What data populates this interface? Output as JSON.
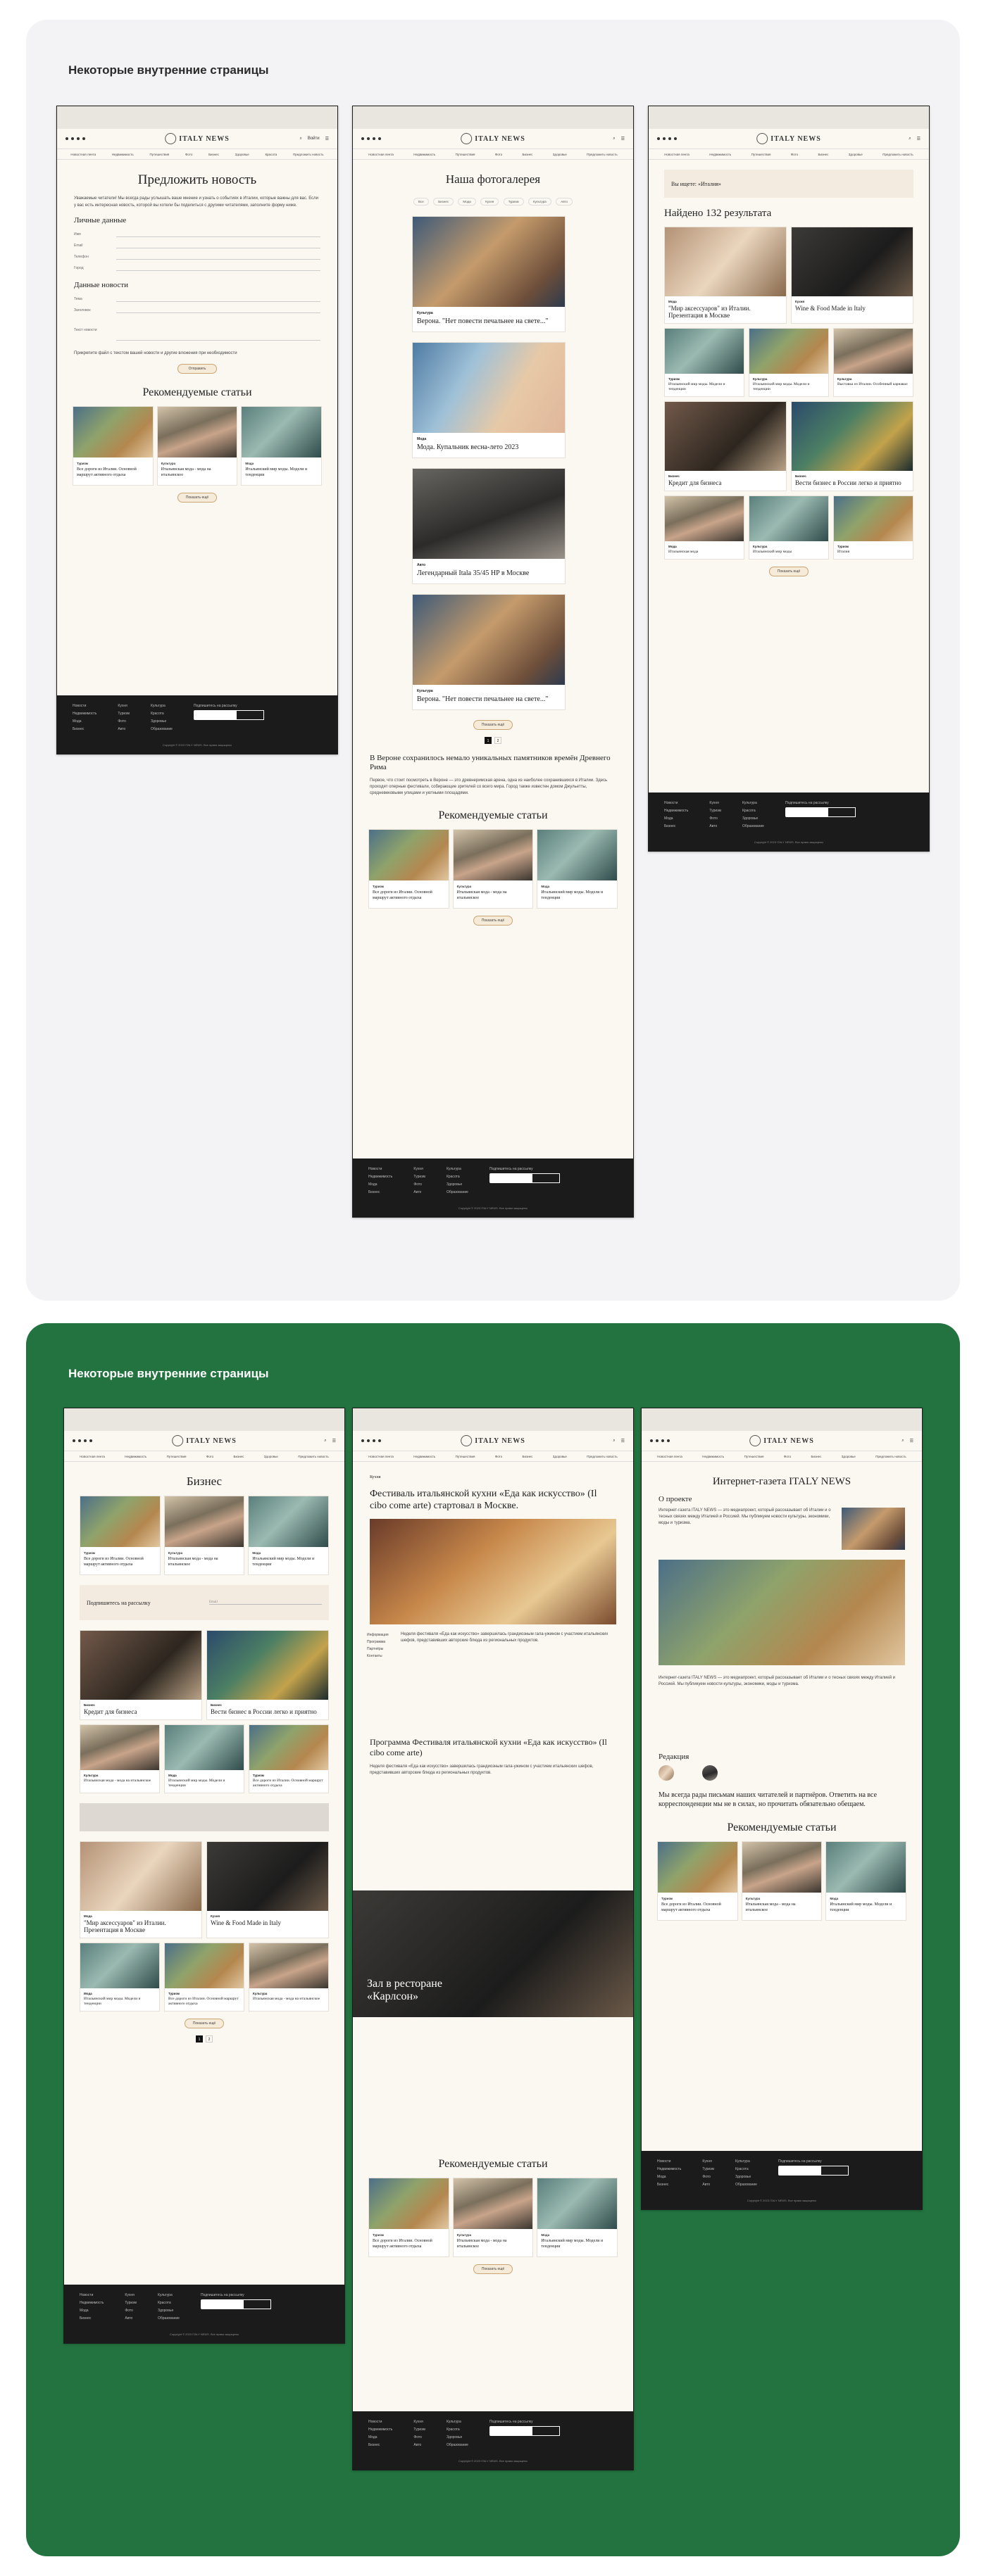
{
  "board1": {
    "title": "Некоторые внутренние страницы"
  },
  "board2": {
    "title": "Некоторые внутренние страницы"
  },
  "logo_text": "ITALY NEWS",
  "nav_items": [
    "Новостная лента",
    "Недвижимость",
    "Путешествия",
    "Фото",
    "Бизнес",
    "Здоровье",
    "Красота",
    "Мода",
    "Туризм",
    "Образование",
    "Культура",
    "Кухня",
    "Предложить новость"
  ],
  "pages": {
    "suggest": {
      "title": "Предложить новость",
      "intro": "Уважаемые читатели! Мы всегда рады услышать ваше мнение и узнать о событиях в Италии, которые важны для вас. Если у вас есть интересная новость, которой вы хотели бы поделиться с другими читателями, заполните форму ниже.",
      "personal_label": "Личные данные",
      "news_label": "Данные новости",
      "fields": [
        "Имя",
        "Email",
        "Телефон",
        "Город",
        "Тема",
        "Заголовок",
        "Текст новости"
      ],
      "attach_label": "Прикрепите файл с текстом вашей новости и другие вложения при необходимости",
      "submit": "Отправить"
    },
    "gallery": {
      "title": "Наша фотогалерея",
      "filters": [
        "Все",
        "Бизнес",
        "Мода",
        "Кухня",
        "Туризм",
        "Культура",
        "Авто"
      ],
      "items": [
        {
          "tag": "Культура",
          "title": "Верона. \"Нет повести печальнее на свете...\""
        },
        {
          "tag": "Мода",
          "title": "Мода. Купальник весна-лето 2023"
        },
        {
          "tag": "Авто",
          "title": "Легендарный Itala 35/45 HP в Москве"
        },
        {
          "tag": "Культура",
          "title": "Верона. \"Нет повести печальнее на свете...\""
        }
      ],
      "more": "Показать ещё",
      "article_title": "В Вероне сохранилось немало уникальных памятников времён Древнего Рима",
      "article_text": "Первое, что стоит посмотреть в Вероне — это древнеримская арена, одна из наиболее сохранившихся в Италии. Здесь проходят оперные фестивали, собирающие зрителей со всего мира. Город также известен домом Джульетты, средневековыми улицами и уютными площадями."
    },
    "search": {
      "result": "Найдено 132 результата",
      "search_value": "Вы ищете: «Италия»",
      "items": [
        {
          "tag": "Мода",
          "title": "\"Мир аксессуаров\" из Италии. Презентация в Москве"
        },
        {
          "tag": "Кухня",
          "title": "Wine & Food Made in Italy"
        },
        {
          "tag": "Туризм",
          "title": "Итальянский мир моды. Модели и тенденции"
        },
        {
          "tag": "Культура",
          "title": "Итальянский мир моды. Модели и тенденции"
        },
        {
          "tag": "Культура",
          "title": "Выставка из Италии. Особенный карнавал"
        },
        {
          "tag": "Бизнес",
          "title": "Кредит для бизнеса"
        },
        {
          "tag": "Бизнес",
          "title": "Вести бизнес в России легко и приятно"
        },
        {
          "tag": "Мода",
          "title": "Итальянская мода"
        },
        {
          "tag": "Культура",
          "title": "Итальянский мир моды"
        },
        {
          "tag": "Туризм",
          "title": "Италия"
        }
      ]
    },
    "business": {
      "title": "Бизнес",
      "subscribe": "Подпишитесь на рассылку",
      "email_placeholder": "Email",
      "items": [
        {
          "tag": "Бизнес",
          "title": "Кредит для бизнеса"
        },
        {
          "tag": "Бизнес",
          "title": "Вести бизнес в России легко и приятно"
        },
        {
          "tag": "Мода",
          "title": "\"Мир аксессуаров\" из Италии. Презентация в Москве"
        },
        {
          "tag": "Кухня",
          "title": "Wine & Food Made in Italy"
        }
      ]
    },
    "festival": {
      "title": "Фестиваль итальянской кухни «Еда как искусство» (Il cibo come arte) стартовал в Москве.",
      "tag": "Кухня",
      "program_title": "Программа Фестиваля итальянской кухни «Еда как искусство» (Il cibo come arte)",
      "hall": "Зал в ресторане «Карлсон»",
      "sidebar": [
        "Информация",
        "Программа",
        "Партнёры",
        "Контакты"
      ],
      "article_text": "Неделя фестиваля «Еда как искусство» завершилась грандиозным гала-ужином с участием итальянских шефов, представивших авторские блюда из региональных продуктов."
    },
    "about": {
      "title": "Интернет-газета ITALY NEWS",
      "section": "О проекте",
      "text": "Интернет-газета ITALY NEWS — это медиапроект, который рассказывает об Италии и о тесных связях между Италией и Россией. Мы публикуем новости культуры, экономики, моды и туризма.",
      "editors": "Редакция",
      "quote": "Мы всегда рады письмам наших читателей и партнёров. Ответить на все корреспонденции мы не в силах, но прочитать обязательно обещаем."
    }
  },
  "recommended": {
    "title": "Рекомендуемые статьи",
    "items": [
      {
        "tag": "Туризм",
        "title": "Все дороги из Италии. Основной маршрут активного отдыха"
      },
      {
        "tag": "Культура",
        "title": "Итальянская мода - мода на итальянское"
      },
      {
        "tag": "Мода",
        "title": "Итальянский мир моды. Модели и тенденции"
      }
    ],
    "more": "Показать ещё"
  },
  "footer": {
    "cols": [
      [
        "Новости",
        "Недвижимость",
        "Мода",
        "Бизнес"
      ],
      [
        "Кухня",
        "Туризм",
        "Фото",
        "Авто"
      ],
      [
        "Культура",
        "Красота",
        "Здоровье",
        "Образование"
      ]
    ],
    "subscribe": "Подпишитесь на рассылку",
    "copy": "Copyright © 2023 ITALY NEWS. Все права защищены"
  }
}
